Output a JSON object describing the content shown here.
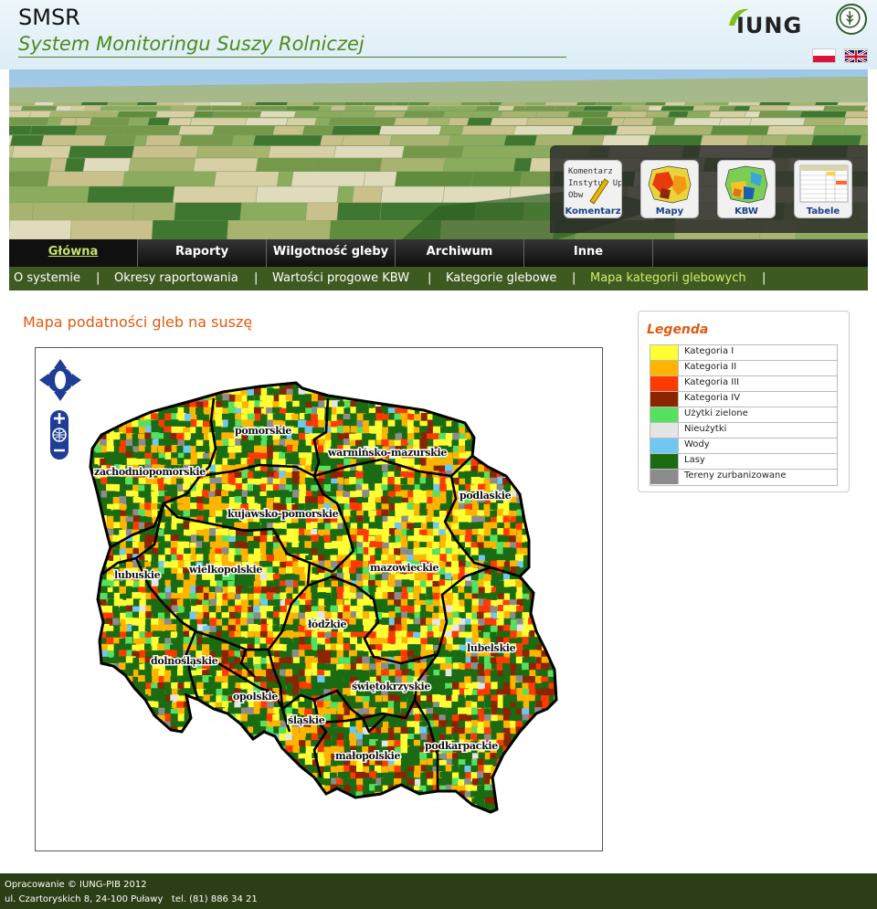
{
  "header": {
    "app_short": "SMSR",
    "app_long": "System Monitoringu Suszy Rolniczej",
    "logo_text": "IUNG",
    "flags": [
      "pl-flag-icon",
      "uk-flag-icon"
    ]
  },
  "quick_links": [
    {
      "label": "Komentarz",
      "icon": "comment-pen-icon",
      "thumb_lines": [
        "Komentarz",
        "Instytut Up",
        "Obw"
      ]
    },
    {
      "label": "Mapy",
      "icon": "map-thumb-icon"
    },
    {
      "label": "KBW",
      "icon": "kbw-map-thumb-icon"
    },
    {
      "label": "Tabele",
      "icon": "table-thumb-icon"
    }
  ],
  "nav": {
    "items": [
      "Główna",
      "Raporty",
      "Wilgotność gleby",
      "Archiwum",
      "Inne"
    ],
    "active": "Główna"
  },
  "subnav": {
    "items": [
      "O systemie",
      "Okresy raportowania",
      "Wartości progowe KBW",
      "Kategorie glebowe",
      "Mapa kategorii glebowych"
    ],
    "current": "Mapa kategorii glebowych",
    "separator": "|"
  },
  "main": {
    "title": "Mapa podatności gleb na suszę",
    "regions": [
      "pomorskie",
      "warmińsko-mazurskie",
      "zachodniopomorskie",
      "podlaskie",
      "kujawsko-pomorskie",
      "lubuskie",
      "wielkopolskie",
      "mazowieckie",
      "łódzkie",
      "lubelskie",
      "dolnośląskie",
      "świętokrzyskie",
      "opolskie",
      "śląskie",
      "podkarpackie",
      "małopolskie"
    ],
    "map_controls": [
      "pan-icon",
      "zoom-in-icon",
      "globe-icon",
      "zoom-out-icon"
    ]
  },
  "legend": {
    "title": "Legenda",
    "items": [
      {
        "label": "Kategoria I",
        "color": "#ffff33"
      },
      {
        "label": "Kategoria II",
        "color": "#ffb400"
      },
      {
        "label": "Kategoria III",
        "color": "#ff3a00"
      },
      {
        "label": "Kategoria IV",
        "color": "#8b2500"
      },
      {
        "label": "Użytki zielone",
        "color": "#55e05f"
      },
      {
        "label": "Nieużytki",
        "color": "#e5e5e5"
      },
      {
        "label": "Wody",
        "color": "#6fc8f2"
      },
      {
        "label": "Lasy",
        "color": "#1a6b12"
      },
      {
        "label": "Tereny zurbanizowane",
        "color": "#8c8c8c"
      }
    ]
  },
  "footer": {
    "line1": "Opracowanie © IUNG-PIB 2012",
    "line2": "ul. Czartoryskich 8, 24-100 Puławy   tel. (81) 886 34 21"
  }
}
